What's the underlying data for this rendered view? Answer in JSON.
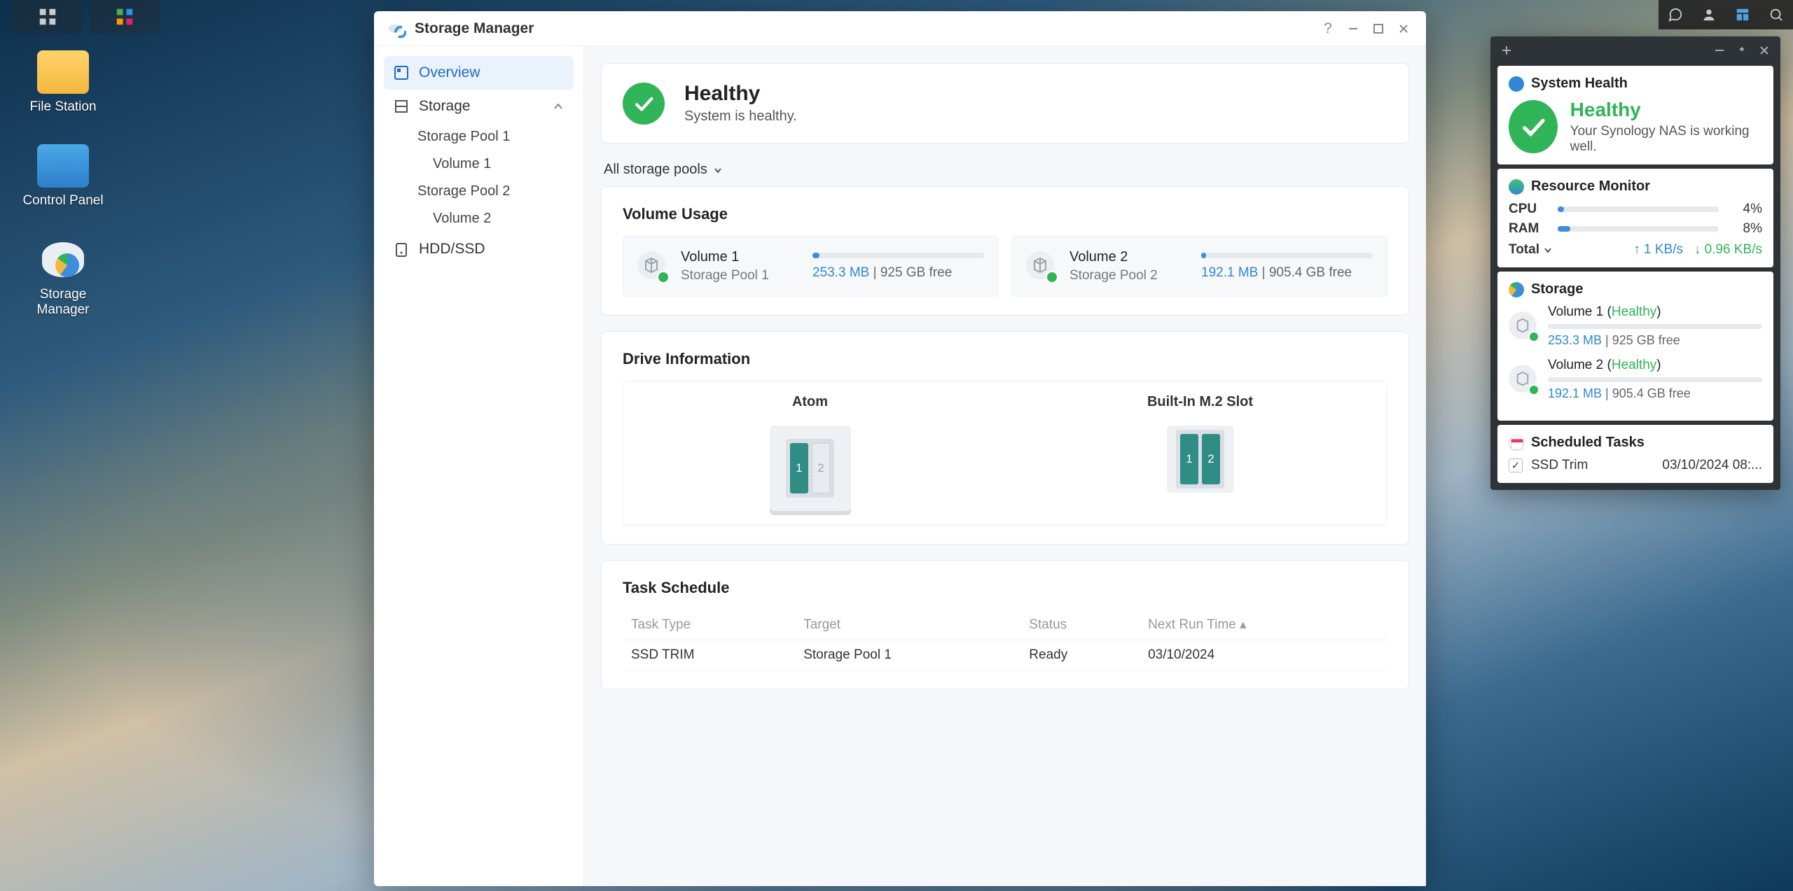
{
  "desktop": {
    "icons": [
      {
        "label": "File Station"
      },
      {
        "label": "Control Panel"
      },
      {
        "label": "Storage Manager"
      }
    ]
  },
  "window": {
    "title": "Storage Manager",
    "sidebar": {
      "overview": "Overview",
      "storage": "Storage",
      "pool1": "Storage Pool 1",
      "vol1": "Volume 1",
      "pool2": "Storage Pool 2",
      "vol2": "Volume 2",
      "hddssd": "HDD/SSD"
    },
    "health": {
      "title": "Healthy",
      "subtitle": "System is healthy."
    },
    "pool_filter": "All storage pools",
    "volume_usage": {
      "heading": "Volume Usage",
      "vols": [
        {
          "title": "Volume 1",
          "pool": "Storage Pool 1",
          "used": "253.3 MB",
          "sep": " | ",
          "free": "925 GB free"
        },
        {
          "title": "Volume 2",
          "pool": "Storage Pool 2",
          "used": "192.1 MB",
          "sep": " | ",
          "free": "905.4 GB free"
        }
      ]
    },
    "drive": {
      "heading": "Drive Information",
      "col1": "Atom",
      "col2": "Built-In M.2 Slot",
      "bays": {
        "a1": "1",
        "a2": "2",
        "m1": "1",
        "m2": "2"
      }
    },
    "tasks": {
      "heading": "Task Schedule",
      "cols": {
        "type": "Task Type",
        "target": "Target",
        "status": "Status",
        "next": "Next Run Time"
      },
      "rows": [
        {
          "type": "SSD TRIM",
          "target": "Storage Pool 1",
          "status": "Ready",
          "next": "03/10/2024"
        }
      ]
    }
  },
  "widgets": {
    "health": {
      "title": "System Health",
      "status": "Healthy",
      "sub": "Your Synology NAS is working well."
    },
    "resmon": {
      "title": "Resource Monitor",
      "cpu_label": "CPU",
      "cpu_val": "4%",
      "ram_label": "RAM",
      "ram_val": "8%",
      "total_label": "Total",
      "up": "1 KB/s",
      "down": "0.96 KB/s"
    },
    "storage": {
      "title": "Storage",
      "vols": [
        {
          "name": "Volume 1",
          "status": "Healthy",
          "used": "253.3 MB",
          "sep": " | ",
          "free": "925 GB free"
        },
        {
          "name": "Volume 2",
          "status": "Healthy",
          "used": "192.1 MB",
          "sep": " | ",
          "free": "905.4 GB free"
        }
      ]
    },
    "sched": {
      "title": "Scheduled Tasks",
      "task": "SSD Trim",
      "time": "03/10/2024 08:..."
    }
  }
}
